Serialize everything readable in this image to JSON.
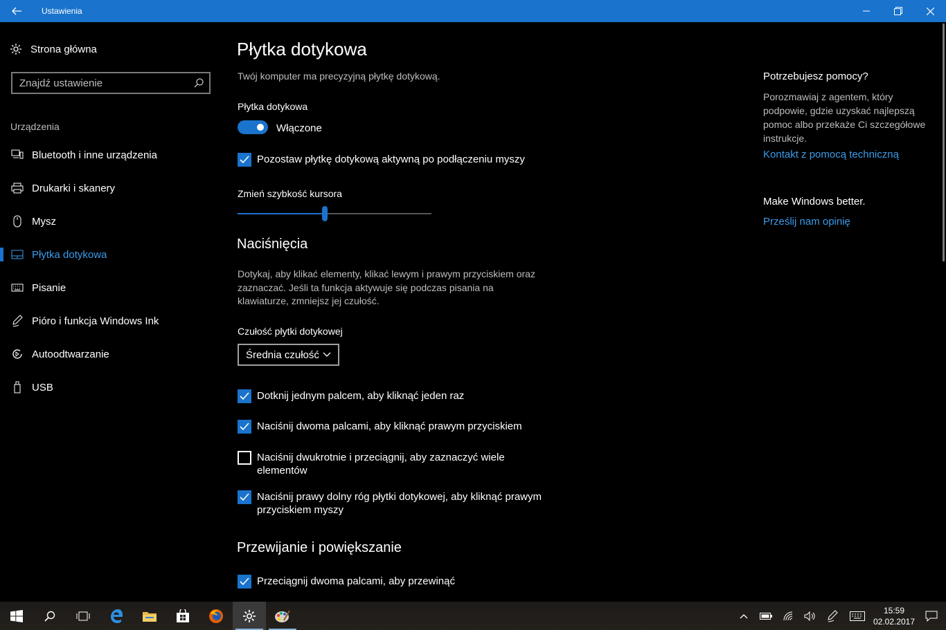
{
  "window": {
    "title": "Ustawienia"
  },
  "sidebar": {
    "home_label": "Strona główna",
    "search_placeholder": "Znajdź ustawienie",
    "section_label": "Urządzenia",
    "items": [
      {
        "label": "Bluetooth i inne urządzenia",
        "icon": "bluetooth-devices-icon"
      },
      {
        "label": "Drukarki i skanery",
        "icon": "printer-icon"
      },
      {
        "label": "Mysz",
        "icon": "mouse-icon"
      },
      {
        "label": "Płytka dotykowa",
        "icon": "touchpad-icon",
        "active": true
      },
      {
        "label": "Pisanie",
        "icon": "keyboard-icon"
      },
      {
        "label": "Pióro i funkcja Windows Ink",
        "icon": "pen-icon"
      },
      {
        "label": "Autoodtwarzanie",
        "icon": "autoplay-icon"
      },
      {
        "label": "USB",
        "icon": "usb-icon"
      }
    ]
  },
  "main": {
    "title": "Płytka dotykowa",
    "subtitle": "Twój komputer ma precyzyjną płytkę dotykową.",
    "touchpad_label": "Płytka dotykowa",
    "toggle_state": "Włączone",
    "leave_on_label": "Pozostaw płytkę dotykową aktywną po podłączeniu myszy",
    "cursor_speed_label": "Zmień szybkość kursora",
    "cursor_speed_value": 0.45,
    "taps_title": "Naciśnięcia",
    "taps_desc": "Dotykaj, aby klikać elementy, klikać lewym i prawym przyciskiem oraz zaznaczać. Jeśli ta funkcja aktywuje się podczas pisania na klawiaturze, zmniejsz jej czułość.",
    "sensitivity_label": "Czułość płytki dotykowej",
    "sensitivity_value": "Średnia czułość",
    "tap_options": [
      {
        "label": "Dotknij jednym palcem, aby kliknąć jeden raz",
        "checked": true
      },
      {
        "label": "Naciśnij dwoma palcami, aby kliknąć prawym przyciskiem",
        "checked": true
      },
      {
        "label": "Naciśnij dwukrotnie i przeciągnij, aby zaznaczyć wiele elementów",
        "checked": false
      },
      {
        "label": "Naciśnij prawy dolny róg płytki dotykowej, aby kliknąć prawym przyciskiem myszy",
        "checked": true
      }
    ],
    "scroll_title": "Przewijanie i powiększanie",
    "scroll_option": "Przeciągnij dwoma palcami, aby przewinąć"
  },
  "help": {
    "title": "Potrzebujesz pomocy?",
    "text": "Porozmawiaj z agentem, który podpowie, gdzie uzyskać najlepszą pomoc albo przekaże Ci szczegółowe instrukcje.",
    "link": "Kontakt z pomocą techniczną",
    "feedback_title": "Make Windows better.",
    "feedback_link": "Prześlij nam opinię"
  },
  "taskbar": {
    "time": "15:59",
    "date": "02.02.2017"
  },
  "colors": {
    "accent": "#1a73cc",
    "link": "#3c9be9",
    "bg": "#000000"
  }
}
